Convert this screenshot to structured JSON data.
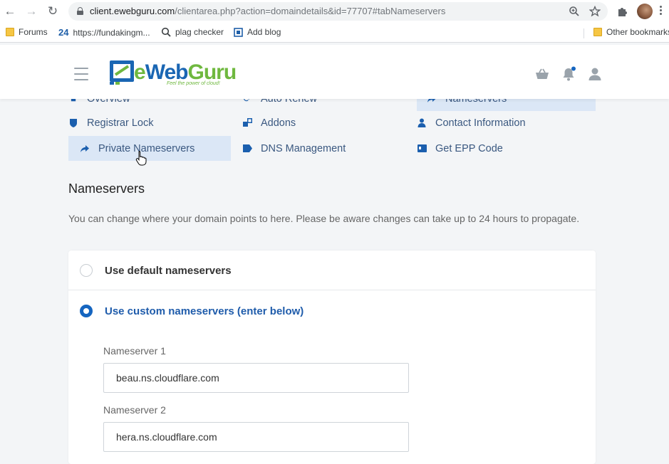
{
  "browser": {
    "url_host": "client.ewebguru.com",
    "url_path": "/clientarea.php?action=domaindetails&id=77707#tabNameservers",
    "bookmarks": [
      {
        "label": "Forums",
        "icon": "folder-icon"
      },
      {
        "label": "https://fundakingm...",
        "icon": "24-icon"
      },
      {
        "label": "plag checker",
        "icon": "search-icon"
      },
      {
        "label": "Add blog",
        "icon": "blog-icon"
      }
    ],
    "other_bookmarks": "Other bookmarks"
  },
  "site": {
    "logo_text_e": "e",
    "logo_text_web": "Web",
    "logo_text_guru": "Guru",
    "logo_tagline": "Feel the power of cloud!",
    "colors": {
      "brand_blue": "#1a66b3",
      "brand_green": "#6fb83f",
      "accent": "#1565c0"
    }
  },
  "tabs": {
    "col1": [
      "Overview",
      "Registrar Lock",
      "Private Nameservers"
    ],
    "col2": [
      "Auto Renew",
      "Addons",
      "DNS Management"
    ],
    "col3": [
      "Nameservers",
      "Contact Information",
      "Get EPP Code"
    ]
  },
  "nameservers": {
    "title": "Nameservers",
    "description": "You can change where your domain points to here. Please be aware changes can take up to 24 hours to propagate.",
    "option_default": "Use default nameservers",
    "option_custom": "Use custom nameservers (enter below)",
    "selected": "custom",
    "fields": [
      {
        "label": "Nameserver 1",
        "value": "beau.ns.cloudflare.com"
      },
      {
        "label": "Nameserver 2",
        "value": "hera.ns.cloudflare.com"
      }
    ]
  }
}
